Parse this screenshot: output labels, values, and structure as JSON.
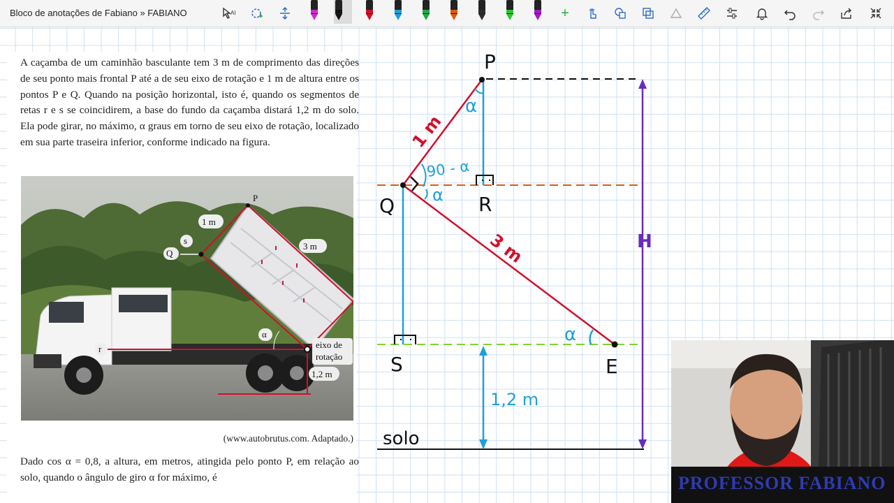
{
  "window": {
    "title": "Bloco de anotações de Fabiano » FABIANO"
  },
  "toolbar": {
    "tools": [
      {
        "name": "lasso-select-icon",
        "glyph": "⌖"
      },
      {
        "name": "shape-select-icon",
        "glyph": "◌"
      },
      {
        "name": "insert-space-icon",
        "glyph": "⇕"
      }
    ],
    "pens": [
      "#d12ad1",
      "#111111",
      "#d0102a",
      "#1ea0d8",
      "#22a84a",
      "#e05a0d",
      "#2c2c2c",
      "#2ec52e",
      "#a418c7"
    ],
    "actions": [
      {
        "name": "add-pen-icon",
        "glyph": "+"
      },
      {
        "name": "touch-draw-icon",
        "glyph": "☝"
      },
      {
        "name": "ink-to-shape-icon",
        "glyph": "⬠"
      },
      {
        "name": "ink-to-text-icon",
        "glyph": "⧉"
      },
      {
        "name": "ink-to-math-icon",
        "glyph": "∡"
      },
      {
        "name": "ruler-icon",
        "glyph": "📏"
      },
      {
        "name": "settings-sliders-icon",
        "glyph": "⚌"
      },
      {
        "name": "notification-bell-icon",
        "glyph": "🔔"
      },
      {
        "name": "undo-icon",
        "glyph": "↶"
      },
      {
        "name": "redo-icon",
        "glyph": "↷"
      },
      {
        "name": "share-icon",
        "glyph": "⇪"
      },
      {
        "name": "fullscreen-exit-icon",
        "glyph": "⤡"
      }
    ]
  },
  "question": {
    "paragraph1": "A caçamba de um caminhão basculante tem 3 m de comprimento das direções de seu ponto mais frontal P até a de seu eixo de rotação e 1 m de altura entre os pontos P e Q. Quando na posição horizontal, isto é, quando os segmentos de retas r e s se coincidirem, a base do fundo da caçamba distará 1,2 m do solo. Ela pode girar, no máximo, α graus em torno de seu eixo de rotação, localizado em sua parte traseira inferior, conforme indicado na figura.",
    "source": "(www.autobrutus.com. Adaptado.)",
    "paragraph2": "Dado cos α = 0,8, a altura, em metros, atingida pelo ponto P, em relação ao solo, quando o ângulo de giro α for máximo, é",
    "photo_labels": {
      "p": "P",
      "one_m": "1 m",
      "s": "s",
      "q": "Q",
      "three_m": "3 m",
      "alpha": "α",
      "r": "r",
      "axis": "eixo de rotação",
      "axis_line1": "eixo de",
      "axis_line2": "rotação",
      "height": "1,2 m"
    }
  },
  "diagram": {
    "points": {
      "p": "P",
      "q": "Q",
      "r": "R",
      "s": "S",
      "e": "E"
    },
    "labels": {
      "one_m": "1 m",
      "three_m": "3 m",
      "angle_90": "90 - α",
      "alpha": "α",
      "height": "H",
      "one_two": "1,2 m",
      "ground": "solo"
    },
    "colors": {
      "red": "#d0102a",
      "blue": "#1ea0d8",
      "orange": "#e05a0d",
      "green": "#7cd42e",
      "purple": "#6a2bbf",
      "black": "#111111"
    }
  },
  "webcam": {
    "name": "PROFESSOR FABIANO"
  }
}
